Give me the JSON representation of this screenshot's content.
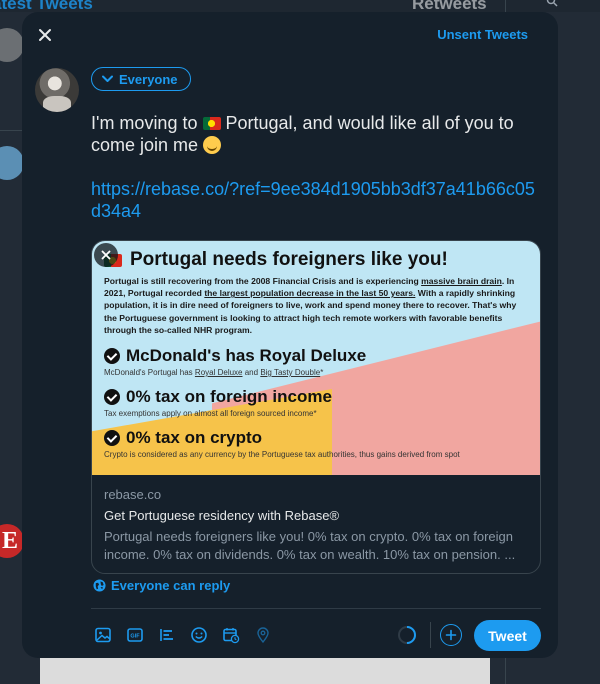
{
  "background": {
    "left_title": "atest Tweets",
    "right_title": "Retweets"
  },
  "modal": {
    "close_icon": "close-icon",
    "unsent_label": "Unsent Tweets",
    "audience_label": "Everyone",
    "tweet_text_part1": "I'm moving to",
    "tweet_text_part2": "Portugal, and would like all of you to come join me",
    "tweet_link": "https://rebase.co/?ref=9ee384d1905bb3df37a41b66c05d34a4",
    "card": {
      "image": {
        "title": "Portugal needs foreigners like you!",
        "paragraph_1": "Portugal is still recovering from the 2008 Financial Crisis and is experiencing",
        "paragraph_u1": "massive brain drain",
        "paragraph_2": ". In 2021, Portugal recorded",
        "paragraph_u2": "the largest population decrease in the last 50 years.",
        "paragraph_3": " With a rapidly shrinking population, it is in dire need of foreigners to live, work and spend money there to recover. That's why the Portuguese government is looking to attract high tech remote workers with favorable benefits through the so-called NHR program.",
        "items": [
          {
            "title": "McDonald's has Royal Deluxe",
            "sub_a": "McDonald's Portugal has",
            "sub_u1": "Royal Deluxe",
            "sub_b": " and",
            "sub_u2": "Big Tasty Double",
            "sub_c": "*"
          },
          {
            "title": "0% tax on foreign income",
            "sub_a": "Tax exemptions apply on almost all foreign sourced income*"
          },
          {
            "title": "0% tax on crypto",
            "sub_a": "Crypto is considered as any currency by the Portuguese tax authorities, thus gains derived from spot"
          }
        ]
      },
      "domain": "rebase.co",
      "title": "Get Portuguese residency with Rebase®",
      "description": "Portugal needs foreigners like you! 0% tax on crypto. 0% tax on foreign income. 0% tax on dividends. 0% tax on wealth. 10% tax on pension. ..."
    },
    "reply_setting": "Everyone can reply",
    "tweet_button": "Tweet"
  },
  "colors": {
    "accent": "#1d9bf0",
    "modal_bg": "#15202b",
    "text": "#e7e9ea",
    "muted": "#8b98a5"
  }
}
